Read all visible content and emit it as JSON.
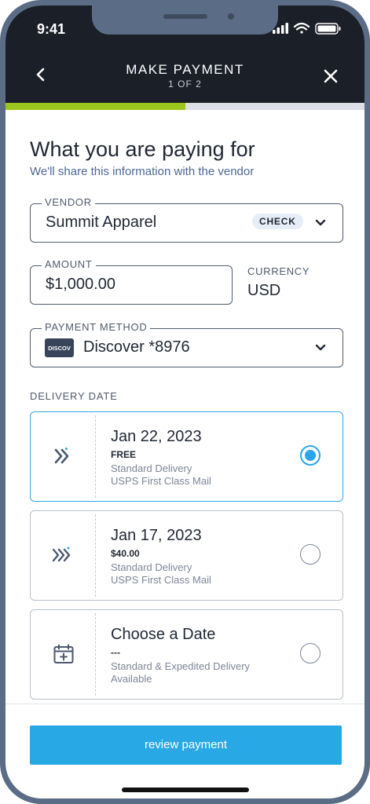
{
  "status_bar": {
    "time": "9:41"
  },
  "header": {
    "title": "MAKE PAYMENT",
    "step": "1 OF 2",
    "progress_fraction": 0.5,
    "progress_color": "#9cc51d"
  },
  "intro": {
    "heading": "What you are paying for",
    "subheading": "We'll share this information with the vendor"
  },
  "vendor": {
    "label": "VENDOR",
    "value": "Summit Apparel",
    "badge": "CHECK"
  },
  "amount": {
    "label": "AMOUNT",
    "value": "$1,000.00"
  },
  "currency": {
    "label": "CURRENCY",
    "value": "USD"
  },
  "payment_method": {
    "label": "PAYMENT METHOD",
    "card_logo": "DISCOV",
    "value": "Discover *8976"
  },
  "delivery": {
    "label": "DELIVERY DATE",
    "options": [
      {
        "icon": "double-chevron-right-icon",
        "date": "Jan 22, 2023",
        "price": "FREE",
        "line1": "Standard Delivery",
        "line2": "USPS First Class Mail",
        "selected": true
      },
      {
        "icon": "triple-chevron-right-icon",
        "date": "Jan 17, 2023",
        "price": "$40.00",
        "line1": "Standard Delivery",
        "line2": "USPS First Class Mail",
        "selected": false
      },
      {
        "icon": "calendar-add-icon",
        "date": "Choose a Date",
        "price": "---",
        "line1": "Standard & Expedited Delivery",
        "line2": "Available",
        "selected": false
      }
    ]
  },
  "actions": {
    "review_label": "review payment"
  },
  "colors": {
    "accent": "#28a9e6",
    "header_bg": "#1b1f27",
    "muted_text": "#4d6796"
  }
}
